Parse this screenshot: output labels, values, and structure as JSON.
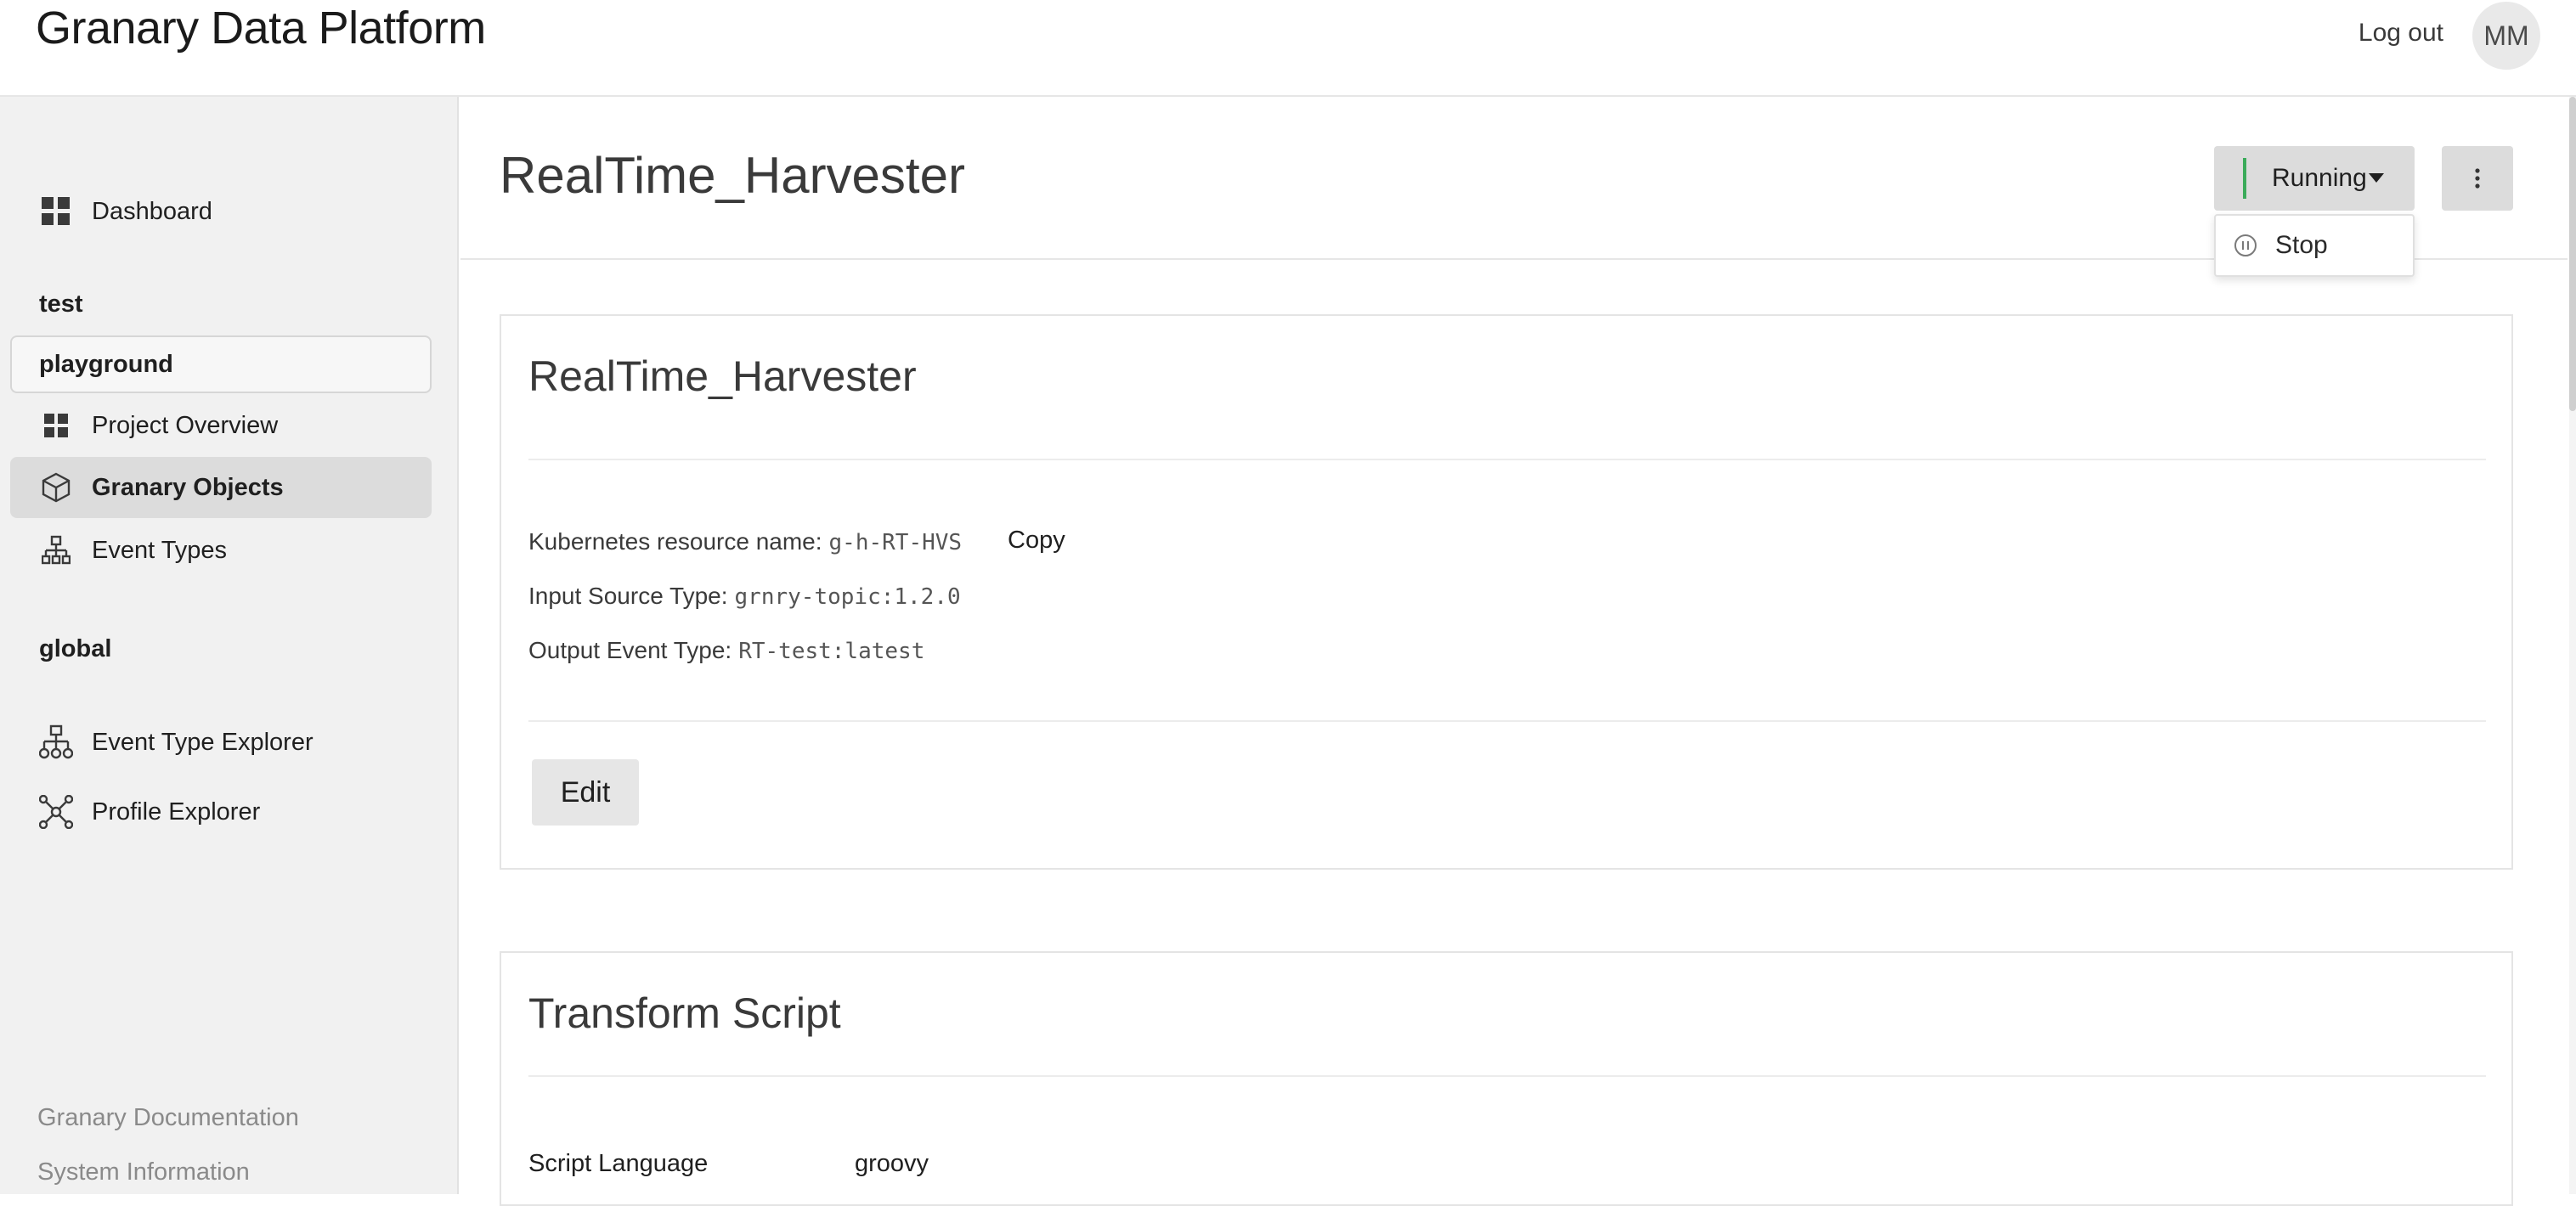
{
  "header": {
    "brand": "Granary Data Platform",
    "logout_label": "Log out",
    "avatar_initials": "MM"
  },
  "sidebar": {
    "dashboard_label": "Dashboard",
    "section_test": "test",
    "project_label": "playground",
    "items": [
      {
        "label": "Project Overview",
        "icon": "grid-icon"
      },
      {
        "label": "Granary Objects",
        "icon": "cube-icon",
        "active": true
      },
      {
        "label": "Event Types",
        "icon": "hierarchy-icon"
      }
    ],
    "section_global": "global",
    "global_items": [
      {
        "label": "Event Type Explorer",
        "icon": "hierarchy-icon"
      },
      {
        "label": "Profile Explorer",
        "icon": "network-icon"
      }
    ],
    "footer": {
      "docs_label": "Granary Documentation",
      "sysinfo_label": "System Information"
    }
  },
  "page": {
    "title": "RealTime_Harvester",
    "status": {
      "label": "Running",
      "color": "#3bab5a"
    },
    "more_icon": "more-vertical-icon",
    "dropdown": {
      "items": [
        {
          "label": "Stop",
          "icon": "pause-circle-icon"
        }
      ]
    }
  },
  "details_card": {
    "title": "RealTime_Harvester",
    "k8s_label": "Kubernetes resource name:",
    "k8s_value": "g-h-RT-HVS",
    "copy_label": "Copy",
    "input_label": "Input Source Type:",
    "input_value": "grnry-topic:1.2.0",
    "output_label": "Output Event Type:",
    "output_value": "RT-test:latest",
    "edit_label": "Edit"
  },
  "transform_card": {
    "title": "Transform Script",
    "language_label": "Script Language",
    "language_value": "groovy"
  }
}
